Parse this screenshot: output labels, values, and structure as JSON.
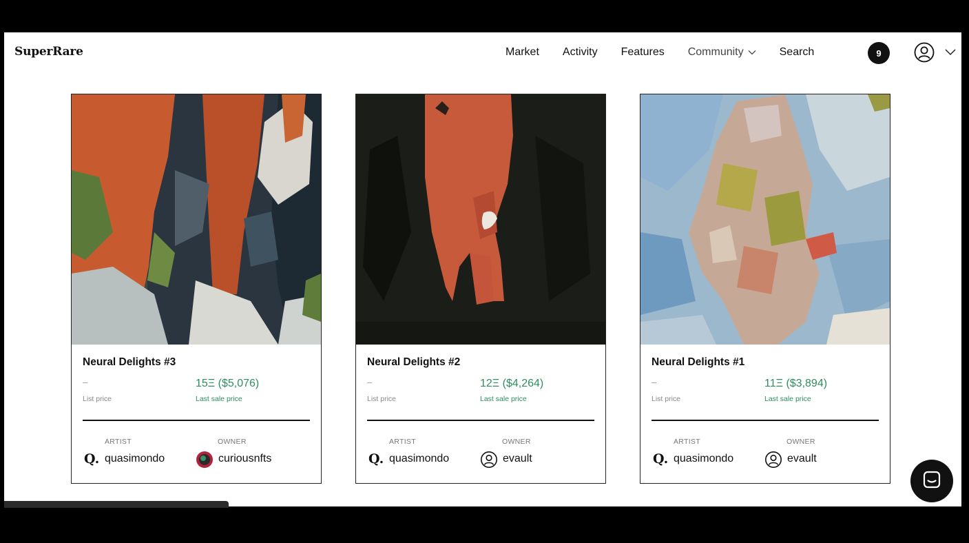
{
  "brand": {
    "name": "SuperRare"
  },
  "nav": {
    "market": "Market",
    "activity": "Activity",
    "features": "Features",
    "community": "Community",
    "search": "Search"
  },
  "notifications": {
    "count": "9"
  },
  "cards": [
    {
      "title": "Neural Delights #3",
      "list_price": "–",
      "list_label": "List price",
      "sale_price": "15Ξ ($5,076)",
      "sale_label": "Last sale price",
      "artist_label": "ARTIST",
      "owner_label": "OWNER",
      "artist": "quasimondo",
      "owner": "curiousnfts"
    },
    {
      "title": "Neural Delights #2",
      "list_price": "–",
      "list_label": "List price",
      "sale_price": "12Ξ ($4,264)",
      "sale_label": "Last sale price",
      "artist_label": "ARTIST",
      "owner_label": "OWNER",
      "artist": "quasimondo",
      "owner": "evault"
    },
    {
      "title": "Neural Delights #1",
      "list_price": "–",
      "list_label": "List price",
      "sale_price": "11Ξ ($3,894)",
      "sale_label": "Last sale price",
      "artist_label": "ARTIST",
      "owner_label": "OWNER",
      "artist": "quasimondo",
      "owner": "evault"
    }
  ],
  "artist_logo": "Q.",
  "colors": {
    "sale_green": "#2f8d5e",
    "text": "#111111"
  },
  "icons": {
    "user": "user-circle-icon",
    "chevron": "chevron-down-icon",
    "chat": "chat-icon"
  }
}
